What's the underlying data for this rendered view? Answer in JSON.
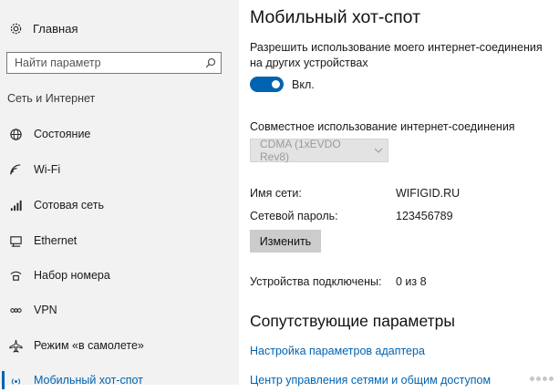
{
  "sidebar": {
    "home_label": "Главная",
    "search_placeholder": "Найти параметр",
    "section_label": "Сеть и Интернет",
    "items": [
      {
        "label": "Состояние",
        "icon": "globe-icon"
      },
      {
        "label": "Wi-Fi",
        "icon": "wifi-icon"
      },
      {
        "label": "Сотовая сеть",
        "icon": "cellular-icon"
      },
      {
        "label": "Ethernet",
        "icon": "ethernet-icon"
      },
      {
        "label": "Набор номера",
        "icon": "dialup-icon"
      },
      {
        "label": "VPN",
        "icon": "vpn-icon"
      },
      {
        "label": "Режим «в самолете»",
        "icon": "airplane-icon"
      },
      {
        "label": "Мобильный хот-спот",
        "icon": "hotspot-icon",
        "active": true
      }
    ]
  },
  "main": {
    "title": "Мобильный хот-спот",
    "allow_text": "Разрешить использование моего интернет-соединения на других устройствах",
    "toggle_state": "Вкл.",
    "share_label": "Совместное использование интернет-соединения",
    "share_select_value": "CDMA (1xEVDO Rev8)",
    "network_name_label": "Имя сети:",
    "network_name_value": "WIFIGID.RU",
    "password_label": "Сетевой пароль:",
    "password_value": "123456789",
    "edit_button": "Изменить",
    "devices_label": "Устройства подключены:",
    "devices_value": "0 из 8",
    "related_title": "Сопутствующие параметры",
    "links": [
      "Настройка параметров адаптера",
      "Центр управления сетями и общим доступом"
    ]
  },
  "colors": {
    "accent": "#0063b1",
    "sidebar_bg": "#f2f2f2"
  }
}
